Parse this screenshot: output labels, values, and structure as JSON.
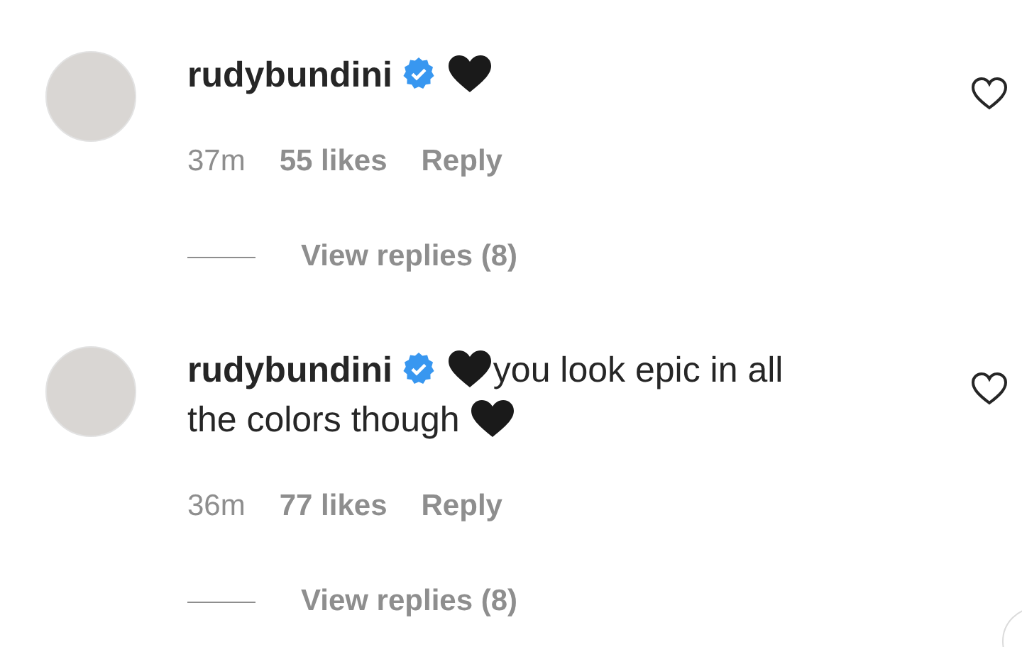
{
  "comments": [
    {
      "username": "rudybundini",
      "verified": true,
      "body": [
        {
          "kind": "heart"
        }
      ],
      "liked": false,
      "time": "37m",
      "likes": "55 likes",
      "reply": "Reply",
      "view_replies": "View replies (8)"
    },
    {
      "username": "rudybundini",
      "verified": true,
      "body": [
        {
          "kind": "heart"
        },
        {
          "kind": "text",
          "text": "you look epic in all"
        },
        {
          "kind": "text",
          "text": "the colors though"
        },
        {
          "kind": "heart"
        }
      ],
      "liked": false,
      "time": "36m",
      "likes": "77 likes",
      "reply": "Reply",
      "view_replies": "View replies (8)"
    }
  ]
}
